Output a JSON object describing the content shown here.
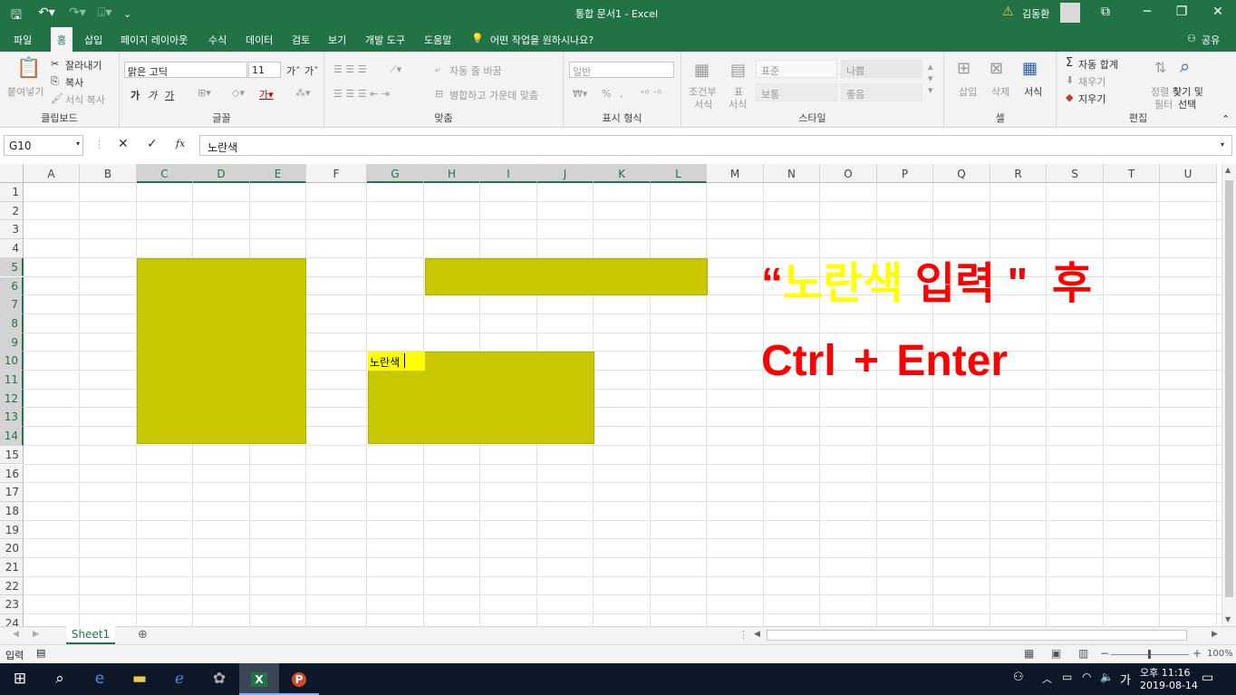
{
  "titlebar": {
    "title": "통합 문서1  -  Excel",
    "user": "김동환",
    "warn": "⚠"
  },
  "tabs": [
    "파일",
    "홈",
    "삽입",
    "페이지 레이아웃",
    "수식",
    "데이터",
    "검토",
    "보기",
    "개발 도구",
    "도움말"
  ],
  "tell_me": "어떤 작업을 원하시나요?",
  "share": "공유",
  "ribbon": {
    "clipboard": {
      "label": "클립보드",
      "paste": "붙여넣기",
      "cut": "잘라내기",
      "copy": "복사",
      "format_painter": "서식 복사"
    },
    "font": {
      "label": "글꼴",
      "font_name": "맑은 고딕",
      "font_size": "11",
      "bold": "가",
      "italic": "가",
      "underline": "가"
    },
    "align": {
      "label": "맞춤",
      "wrap": "자동 줄 바꿈",
      "merge": "병합하고 가운데 맞춤"
    },
    "number": {
      "label": "표시 형식",
      "format": "일반",
      "percent": "%",
      "comma": ","
    },
    "styles": {
      "label": "스타일",
      "cond": "조건부",
      "cond2": "서식",
      "table": "표",
      "table2": "서식",
      "normal": "표준",
      "bad": "나쁨",
      "neutral": "보통",
      "good": "좋음"
    },
    "cells": {
      "label": "셀",
      "insert": "삽입",
      "delete": "삭제",
      "format": "서식"
    },
    "editing": {
      "label": "편집",
      "autosum": "자동 합계",
      "fill": "채우기",
      "clear": "지우기",
      "sort": "정렬 및",
      "sort2": "필터",
      "find": "찾기 및",
      "find2": "선택"
    }
  },
  "formula_bar": {
    "name_box": "G10",
    "cancel": "✕",
    "enter": "✓",
    "fx": "fx",
    "content": "노란색"
  },
  "columns": [
    "A",
    "B",
    "C",
    "D",
    "E",
    "F",
    "G",
    "H",
    "I",
    "J",
    "K",
    "L",
    "M",
    "N",
    "O",
    "P",
    "Q",
    "R",
    "S",
    "T",
    "U"
  ],
  "rows": [
    "1",
    "2",
    "3",
    "4",
    "5",
    "6",
    "7",
    "8",
    "9",
    "10",
    "11",
    "12",
    "13",
    "14",
    "15",
    "16",
    "17",
    "18",
    "19",
    "20",
    "21",
    "22",
    "23",
    "24"
  ],
  "active_cell_text": "노란색",
  "annotation": {
    "open_quote": "“",
    "yellow_word": "노란색",
    "middle": " 입력 \"  후",
    "line2": "Ctrl + Enter"
  },
  "sheet_tab": "Sheet1",
  "status": {
    "mode": "입력",
    "zoom": "100%"
  },
  "taskbar": {
    "ampm_time": "오후 11:16",
    "date": "2019-08-14",
    "ime": "가"
  },
  "colors": {
    "excel_green": "#217346",
    "fill_yellow": "#c8c800",
    "active_yellow": "#ffff00",
    "annotation_red": "#ff0000",
    "annotation_yellow": "#ffff00"
  }
}
